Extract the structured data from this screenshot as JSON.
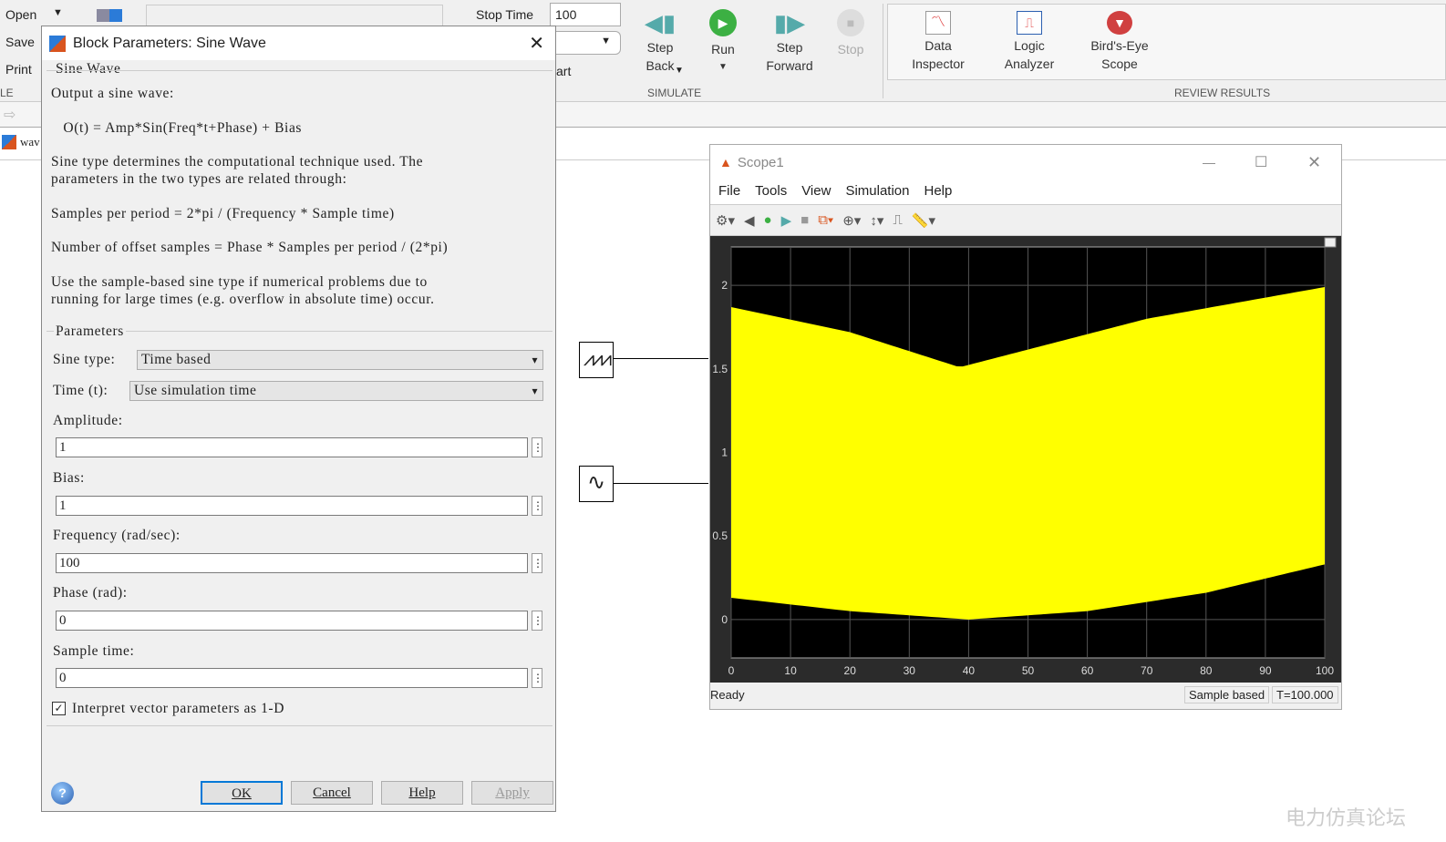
{
  "ribbon": {
    "file": {
      "open": "Open",
      "save": "Save",
      "print": "Print",
      "section": "LE"
    },
    "stop_time_label": "Stop Time",
    "stop_time_value": "100",
    "hidden_label_fragment": "art",
    "simulate": {
      "step_back": "Step\nBack",
      "run": "Run",
      "step_forward": "Step\nForward",
      "stop": "Stop",
      "section": "SIMULATE"
    },
    "review": {
      "data_inspector": "Data\nInspector",
      "logic_analyzer": "Logic\nAnalyzer",
      "birds_eye": "Bird's-Eye\nScope",
      "section": "REVIEW RESULTS"
    }
  },
  "model_tab": "wav",
  "dialog": {
    "title": "Block Parameters: Sine Wave",
    "group_title": "Sine Wave",
    "description": [
      "Output a sine wave:",
      "   O(t) = Amp*Sin(Freq*t+Phase) + Bias",
      "Sine type determines the computational technique used. The",
      "parameters in the two types are related through:",
      "Samples per period = 2*pi / (Frequency * Sample time)",
      "Number of offset samples = Phase * Samples per period / (2*pi)",
      "Use the sample-based sine type if numerical problems due to",
      "running for large times (e.g. overflow in absolute time) occur."
    ],
    "params_title": "Parameters",
    "sine_type_label": "Sine type:",
    "sine_type_value": "Time based",
    "time_label": "Time (t):",
    "time_value": "Use simulation time",
    "fields": [
      {
        "label": "Amplitude:",
        "value": "1"
      },
      {
        "label": "Bias:",
        "value": "1"
      },
      {
        "label": "Frequency (rad/sec):",
        "value": "100"
      },
      {
        "label": "Phase (rad):",
        "value": "0"
      },
      {
        "label": "Sample time:",
        "value": "0"
      }
    ],
    "checkbox_label": "Interpret vector parameters as 1-D",
    "checkbox_checked": true,
    "buttons": {
      "ok": "OK",
      "cancel": "Cancel",
      "help": "Help",
      "apply": "Apply"
    }
  },
  "scope": {
    "title": "Scope1",
    "menu": [
      "File",
      "Tools",
      "View",
      "Simulation",
      "Help"
    ],
    "status": "Ready",
    "mode": "Sample based",
    "time": "T=100.000"
  },
  "watermark": "电力仿真论坛",
  "chart_data": {
    "type": "area",
    "xlim": [
      0,
      100
    ],
    "ylim": [
      -0.23,
      2.23
    ],
    "xticks": [
      0,
      10,
      20,
      30,
      40,
      50,
      60,
      70,
      80,
      90,
      100
    ],
    "yticks": [
      0,
      0.5,
      1,
      1.5,
      2
    ],
    "grid": true,
    "background": "#000000",
    "fill_color": "#ffff00",
    "upper": {
      "x": [
        0,
        20,
        38.5,
        70,
        100
      ],
      "y": [
        1.87,
        1.72,
        1.51,
        1.8,
        1.99
      ]
    },
    "lower": {
      "x": [
        0,
        20,
        40,
        60,
        80,
        100
      ],
      "y": [
        0.13,
        0.05,
        0.0,
        0.05,
        0.16,
        0.33
      ]
    }
  }
}
